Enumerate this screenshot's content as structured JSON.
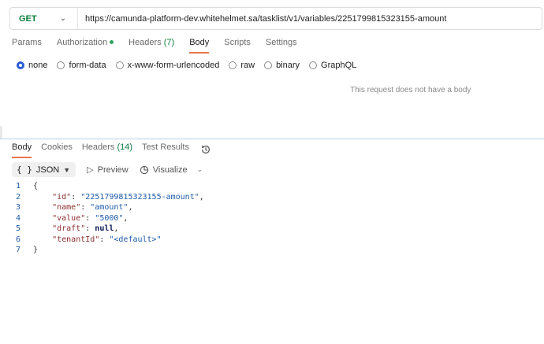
{
  "request": {
    "method": "GET",
    "url": "https://camunda-platform-dev.whitehelmet.sa/tasklist/v1/variables/2251799815323155-amount",
    "tabs": [
      {
        "label": "Params"
      },
      {
        "label": "Authorization"
      },
      {
        "label": "Headers",
        "count": "(7)"
      },
      {
        "label": "Body"
      },
      {
        "label": "Scripts"
      },
      {
        "label": "Settings"
      }
    ],
    "active_tab": "Body",
    "body_types": [
      "none",
      "form-data",
      "x-www-form-urlencoded",
      "raw",
      "binary",
      "GraphQL"
    ],
    "selected_body_type": "none",
    "no_body_message": "This request does not have a body"
  },
  "response": {
    "tabs": [
      {
        "label": "Body"
      },
      {
        "label": "Cookies"
      },
      {
        "label": "Headers",
        "count": "(14)"
      },
      {
        "label": "Test Results"
      }
    ],
    "active_tab": "Body",
    "format": "JSON",
    "preview_label": "Preview",
    "visualize_label": "Visualize",
    "lines": [
      {
        "n": "1",
        "text": "{"
      },
      {
        "n": "2",
        "key": "\"id\"",
        "value": "\"2251799815323155-amount\"",
        "type": "string"
      },
      {
        "n": "3",
        "key": "\"name\"",
        "value": "\"amount\"",
        "type": "string"
      },
      {
        "n": "4",
        "key": "\"value\"",
        "value": "\"5000\"",
        "type": "string"
      },
      {
        "n": "5",
        "key": "\"draft\"",
        "value": "null",
        "type": "keyword"
      },
      {
        "n": "6",
        "key": "\"tenantId\"",
        "value": "\"<default>\"",
        "type": "string",
        "last": true
      },
      {
        "n": "7",
        "text": "}"
      }
    ]
  },
  "colors": {
    "accent": "#e8764c",
    "method_green": "#0b7c3e",
    "radio_blue": "#2a5bd7"
  }
}
